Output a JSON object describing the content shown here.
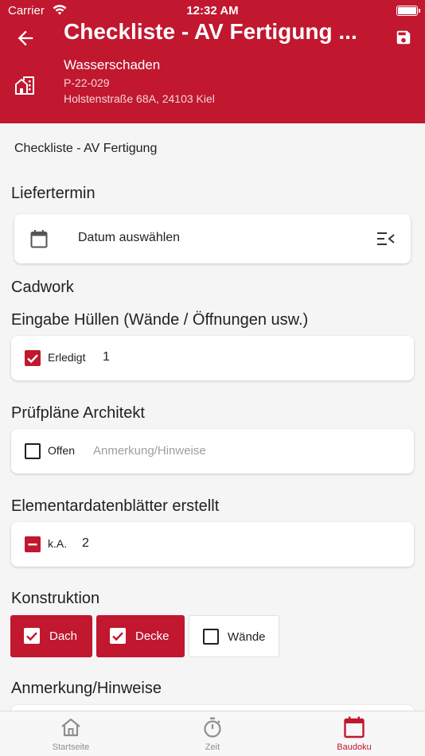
{
  "status_bar": {
    "carrier": "Carrier",
    "time": "12:32 AM"
  },
  "header": {
    "title": "Checkliste - AV Fertigung ...",
    "project_name": "Wasserschaden",
    "project_number": "P-22-029",
    "project_address": "Holstenstraße 68A, 24103 Kiel",
    "accent_color": "#c1172f"
  },
  "subtitle": "Checkliste - AV Fertigung",
  "liefertermin": {
    "label": "Liefertermin",
    "date_placeholder": "Datum auswählen"
  },
  "cadwork": {
    "label": "Cadwork"
  },
  "items": [
    {
      "label": "Eingabe Hüllen (Wände / Öffnungen usw.)",
      "state": "checked",
      "status": "Erledigt",
      "note": "1"
    },
    {
      "label": "Prüfpläne Architekt",
      "state": "unchecked",
      "status": "Offen",
      "note": "",
      "note_placeholder": "Anmerkung/Hinweise"
    },
    {
      "label": "Elementardatenblätter erstellt",
      "state": "indeterminate",
      "status": "k.A.",
      "note": "2"
    }
  ],
  "konstruktion": {
    "label": "Konstruktion",
    "options": [
      {
        "label": "Dach",
        "selected": true
      },
      {
        "label": "Decke",
        "selected": true
      },
      {
        "label": "Wände",
        "selected": false
      }
    ]
  },
  "anmerkung": {
    "label": "Anmerkung/Hinweise"
  },
  "bottom_nav": [
    {
      "label": "Startseite",
      "icon": "home-icon",
      "active": false
    },
    {
      "label": "Zeit",
      "icon": "stopwatch-icon",
      "active": false
    },
    {
      "label": "Baudoku",
      "icon": "calendar-icon",
      "active": true
    }
  ]
}
